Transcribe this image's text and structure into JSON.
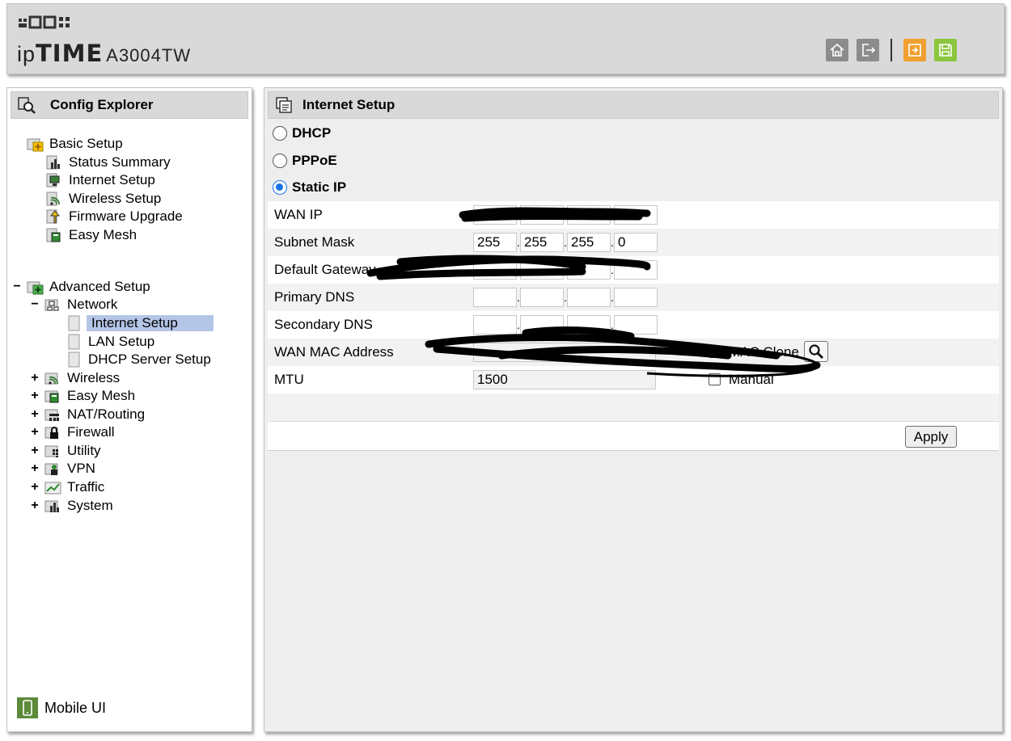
{
  "header": {
    "brand_prefix": "ip",
    "brand_name": "TIME",
    "model": "A3004TW",
    "icons": [
      "home-icon",
      "logout-icon",
      "apply-config-icon",
      "save-icon"
    ]
  },
  "sidebar": {
    "title": "Config Explorer",
    "basic": {
      "label": "Basic Setup",
      "items": [
        "Status Summary",
        "Internet Setup",
        "Wireless Setup",
        "Firmware Upgrade",
        "Easy Mesh"
      ]
    },
    "advanced": {
      "toggle": "−",
      "label": "Advanced Setup",
      "network": {
        "toggle": "−",
        "label": "Network",
        "items": [
          "Internet Setup",
          "LAN Setup",
          "DHCP Server Setup"
        ],
        "selected": "Internet Setup"
      },
      "groups": [
        {
          "toggle": "+",
          "label": "Wireless"
        },
        {
          "toggle": "+",
          "label": "Easy Mesh"
        },
        {
          "toggle": "+",
          "label": "NAT/Routing"
        },
        {
          "toggle": "+",
          "label": "Firewall"
        },
        {
          "toggle": "+",
          "label": "Utility"
        },
        {
          "toggle": "+",
          "label": "VPN"
        },
        {
          "toggle": "+",
          "label": "Traffic"
        },
        {
          "toggle": "+",
          "label": "System"
        }
      ]
    },
    "mobile_ui": "Mobile UI"
  },
  "main": {
    "title": "Internet Setup",
    "connection_types": [
      {
        "label": "DHCP",
        "checked": false
      },
      {
        "label": "PPPoE",
        "checked": false
      },
      {
        "label": "Static IP",
        "checked": true
      }
    ],
    "fields": {
      "wan_ip": {
        "label": "WAN IP",
        "octets": [
          "",
          "",
          "",
          ""
        ]
      },
      "subnet_mask": {
        "label": "Subnet Mask",
        "octets": [
          "255",
          "255",
          "255",
          "0"
        ]
      },
      "default_gateway": {
        "label": "Default Gateway",
        "octets": [
          "",
          "",
          "",
          ""
        ]
      },
      "primary_dns": {
        "label": "Primary DNS",
        "octets": [
          "",
          "",
          "",
          ""
        ]
      },
      "secondary_dns": {
        "label": "Secondary DNS",
        "octets": [
          "",
          "",
          "",
          ""
        ]
      },
      "wan_mac": {
        "label": "WAN MAC Address",
        "value": "",
        "checkbox_label": "MAC Clone"
      },
      "mtu": {
        "label": "MTU",
        "value": "1500",
        "checkbox_label": "Manual"
      }
    },
    "apply_label": "Apply"
  },
  "colors": {
    "panel_gray": "#d9d9d9",
    "selected_bg": "#b4c6e7",
    "radio_blue": "#1a73e8",
    "apply_icon": "#f0a030",
    "save_icon": "#8cc63f"
  }
}
